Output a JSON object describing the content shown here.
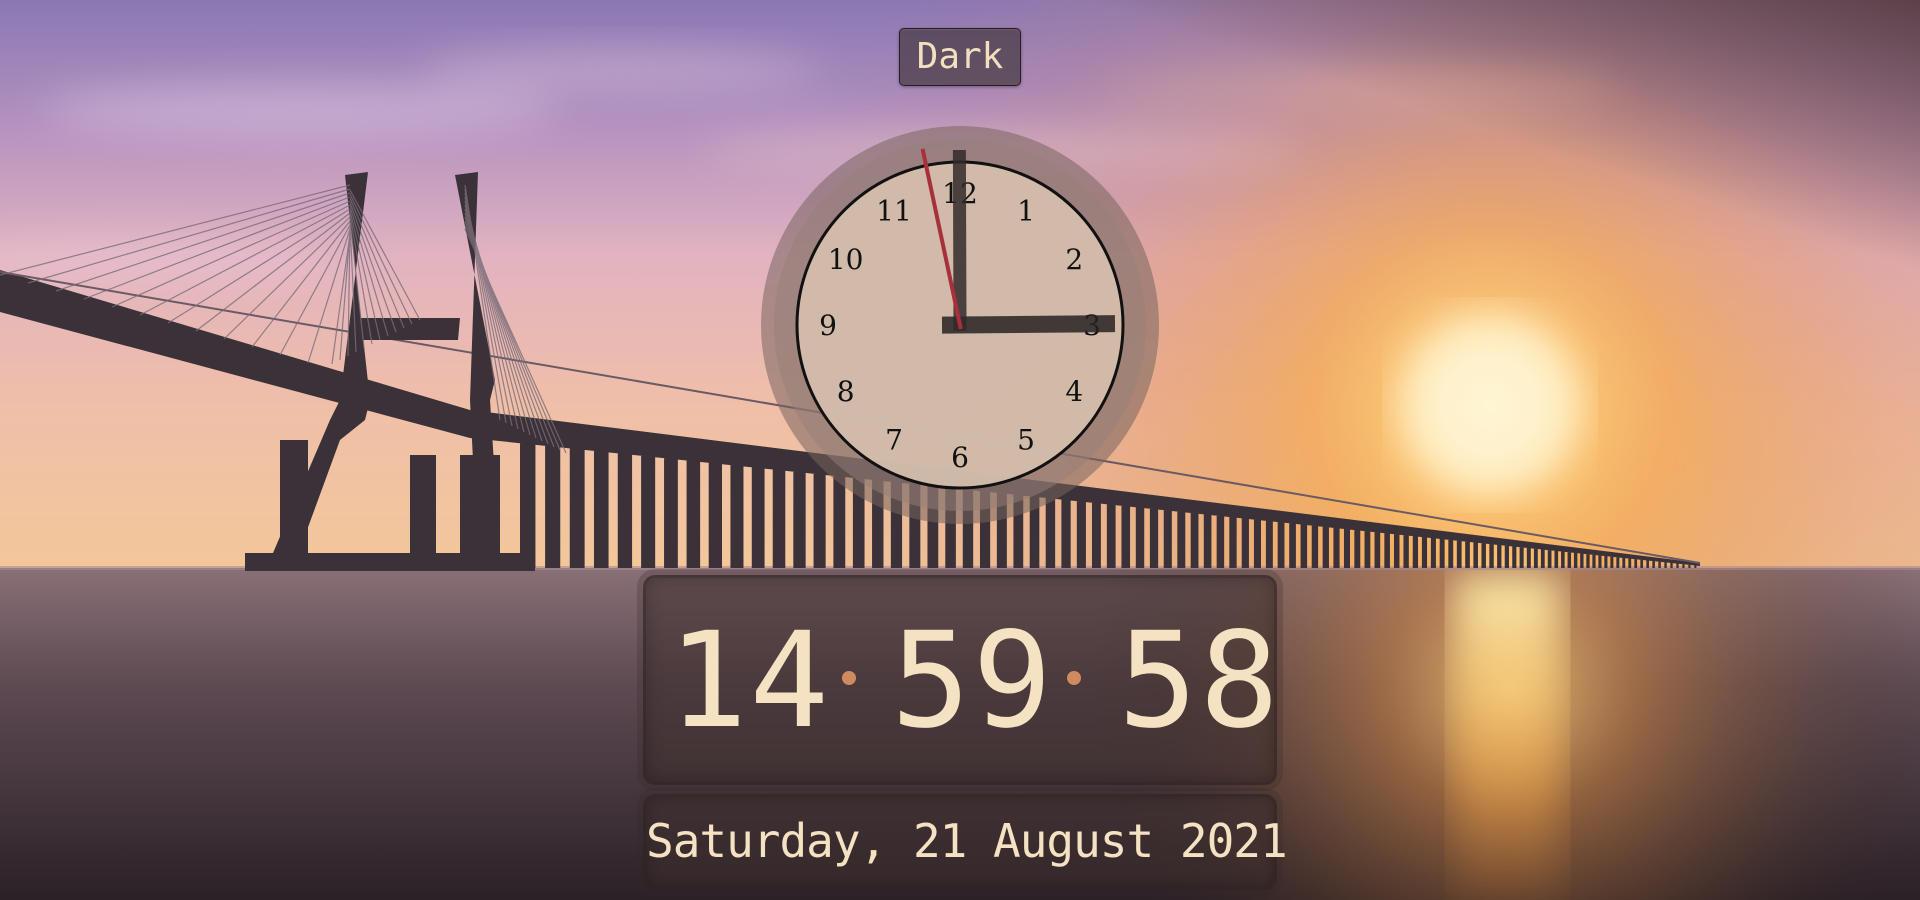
{
  "theme_toggle": {
    "label": "Dark"
  },
  "analog_clock": {
    "numerals": [
      "12",
      "1",
      "2",
      "3",
      "4",
      "5",
      "6",
      "7",
      "8",
      "9",
      "10",
      "11"
    ],
    "hour": 14,
    "minute": 59,
    "second": 58
  },
  "digital_clock": {
    "hours": "14",
    "minutes": "59",
    "seconds": "58",
    "separator": ":"
  },
  "date": {
    "text": "Saturday, 21 August 2021"
  },
  "colors": {
    "text": "#f4e2c3",
    "separator": "#d08a60",
    "second_hand": "#a8303a"
  }
}
